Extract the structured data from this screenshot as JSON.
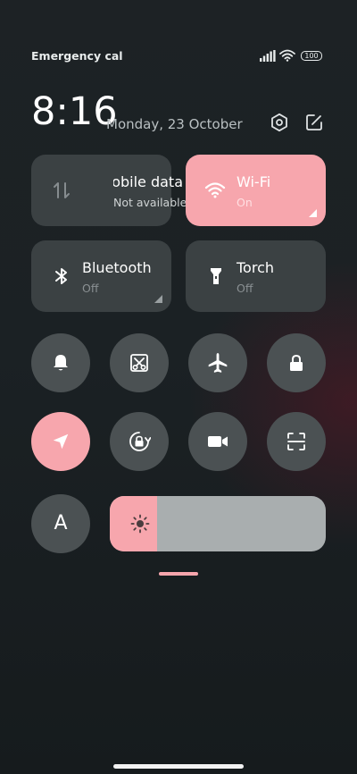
{
  "status_bar": {
    "carrier_text": "Emergency calls only",
    "battery_level": "100"
  },
  "header": {
    "time": "8:16",
    "date": "Monday, 23 October"
  },
  "tiles": {
    "mobile_data": {
      "title": "Mobile data",
      "status": "Not available"
    },
    "wifi": {
      "title": "Wi-Fi",
      "status": "On"
    },
    "bluetooth": {
      "title": "Bluetooth",
      "status": "Off"
    },
    "torch": {
      "title": "Torch",
      "status": "Off"
    }
  },
  "font_button": {
    "label": "A"
  },
  "brightness": {
    "level": 0.22
  },
  "colors": {
    "accent": "#f7a6ad",
    "tile_inactive": "#3b4143",
    "round_inactive": "#4b5153",
    "slider_track": "#a9aeaf"
  },
  "icons": {
    "mobile_data": "arrows-up-down-icon",
    "wifi": "wifi-icon",
    "bluetooth": "bluetooth-icon",
    "torch": "flashlight-icon",
    "row1": [
      "bell-icon",
      "screenshot-icon",
      "airplane-icon",
      "lock-icon"
    ],
    "row2": [
      "location-icon",
      "rotation-lock-icon",
      "video-camera-icon",
      "scanner-icon"
    ],
    "brightness": "sun-icon"
  }
}
